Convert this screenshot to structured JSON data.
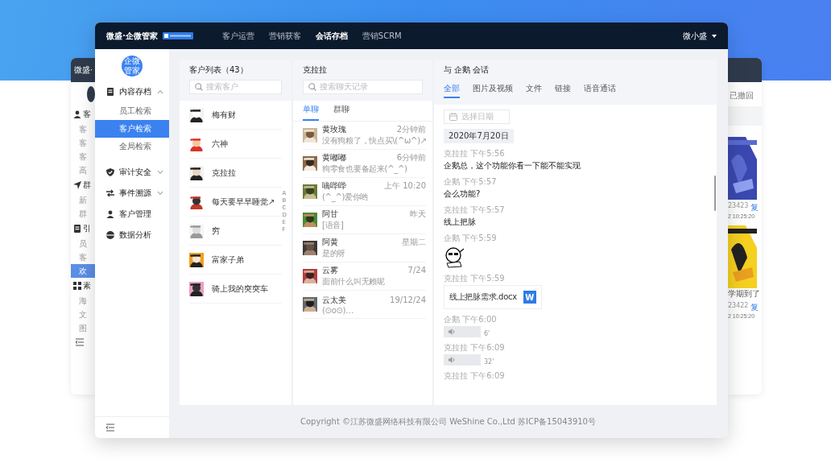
{
  "background_window": {
    "header_text": "微盛·",
    "left_items": [
      {
        "text": "客",
        "kind": "group",
        "selected": false
      },
      {
        "text": "客",
        "kind": "item",
        "selected": false
      },
      {
        "text": "客",
        "kind": "item",
        "selected": false
      },
      {
        "text": "客",
        "kind": "item",
        "selected": false
      },
      {
        "text": "高",
        "kind": "item",
        "selected": false
      },
      {
        "text": "群",
        "kind": "group",
        "selected": false
      },
      {
        "text": "新",
        "kind": "item",
        "selected": false
      },
      {
        "text": "群",
        "kind": "item",
        "selected": false
      },
      {
        "text": "引",
        "kind": "group",
        "selected": false
      },
      {
        "text": "员",
        "kind": "item",
        "selected": false
      },
      {
        "text": "客",
        "kind": "item",
        "selected": false
      },
      {
        "text": "欢",
        "kind": "item",
        "selected": true
      },
      {
        "text": "素",
        "kind": "group",
        "selected": false
      },
      {
        "text": "海",
        "kind": "item",
        "selected": false
      },
      {
        "text": "文",
        "kind": "item",
        "selected": false
      },
      {
        "text": "图",
        "kind": "item",
        "selected": false
      }
    ],
    "status": "已撤回",
    "cards": [
      {
        "count": "23423",
        "link": "复",
        "time": "2 10:25:20"
      },
      {
        "caption": "学期到了",
        "count": "23422",
        "link": "复",
        "time": "2 10:25:20"
      }
    ]
  },
  "window": {
    "brand": "微盛·企微管家",
    "nav": [
      {
        "label": "客户运营",
        "selected": false
      },
      {
        "label": "营销获客",
        "selected": false
      },
      {
        "label": "会话存档",
        "selected": true
      },
      {
        "label": "营销SCRM",
        "selected": false
      }
    ],
    "user": "微小盛"
  },
  "sidebar": {
    "logo": "企微管家",
    "items": [
      {
        "label": "内容存档",
        "expanded": true,
        "children": [
          {
            "label": "员工检索",
            "selected": false
          },
          {
            "label": "客户检索",
            "selected": true
          },
          {
            "label": "全局检索",
            "selected": false
          }
        ]
      },
      {
        "label": "审计安全",
        "expanded": false
      },
      {
        "label": "事件溯源",
        "expanded": false
      },
      {
        "label": "客户管理"
      },
      {
        "label": "数据分析"
      }
    ]
  },
  "customers": {
    "title": "客户列表（43）",
    "search": {
      "placeholder": "搜索客户"
    },
    "items": [
      {
        "name": "梅有财"
      },
      {
        "name": "六神"
      },
      {
        "name": "克拉拉"
      },
      {
        "name": "每天要早早睡觉↗"
      },
      {
        "name": "穷"
      },
      {
        "name": "富家子弟"
      },
      {
        "name": "骑上我的突突车"
      }
    ],
    "index": [
      "A",
      "B",
      "C",
      "D",
      "E",
      "F"
    ]
  },
  "chats": {
    "title": "克拉拉",
    "search": {
      "placeholder": "搜索聊天记录"
    },
    "tabs": [
      {
        "label": "单聊",
        "selected": true
      },
      {
        "label": "群聊",
        "selected": false
      }
    ],
    "items": [
      {
        "name": "黄玫瑰",
        "preview": "没有狗粮了，快点买\\(^ω^)↗",
        "time": "2分钟前"
      },
      {
        "name": "黄嘟嘟",
        "preview": "狗零食也要备起来(^_^)",
        "time": "6分钟前"
      },
      {
        "name": "嘀哔哔",
        "preview": "(^_^)爱你哟",
        "time": "上午 10:20"
      },
      {
        "name": "阿甘",
        "preview": "[语音]",
        "time": "昨天"
      },
      {
        "name": "阿黄",
        "preview": "是的呀",
        "time": "星期二"
      },
      {
        "name": "云雾",
        "preview": "面前什么叫无赖呢",
        "time": "7/24"
      },
      {
        "name": "云太美",
        "preview": "(⊙o⊙)…",
        "time": "19/12/24"
      }
    ]
  },
  "conversation": {
    "title": "与 企鹅 会话",
    "tabs": [
      {
        "label": "全部",
        "selected": true
      },
      {
        "label": "图片及视频",
        "selected": false
      },
      {
        "label": "文件",
        "selected": false
      },
      {
        "label": "链接",
        "selected": false
      },
      {
        "label": "语音通话",
        "selected": false
      }
    ],
    "date_picker": {
      "placeholder": "选择日期"
    },
    "date": "2020年7月20日",
    "messages": [
      {
        "kind": "text",
        "header": "克拉拉 下午5:56",
        "text": "企鹅总，这个功能你看一下能不能实现"
      },
      {
        "kind": "text",
        "header": "企鹅 下午5:57",
        "text": "会么功能?"
      },
      {
        "kind": "text",
        "header": "克拉拉 下午5:57",
        "text": "线上把脉"
      },
      {
        "kind": "sticker",
        "header": "企鹅 下午5:59"
      },
      {
        "kind": "file",
        "header": "克拉拉 下午5:59",
        "file_name": "线上把脉需求.docx",
        "file_badge": "W"
      },
      {
        "kind": "voice",
        "header": "企鹅 下午6:00",
        "duration": "6'"
      },
      {
        "kind": "voice",
        "header": "克拉拉 下午6:09",
        "duration": "32'"
      },
      {
        "kind": "cut",
        "header": "克拉拉 下午6:09"
      }
    ]
  },
  "footer": "Copyright ©江苏微盛网络科技有限公司 WeShine Co.,Ltd 苏ICP备15043910号"
}
